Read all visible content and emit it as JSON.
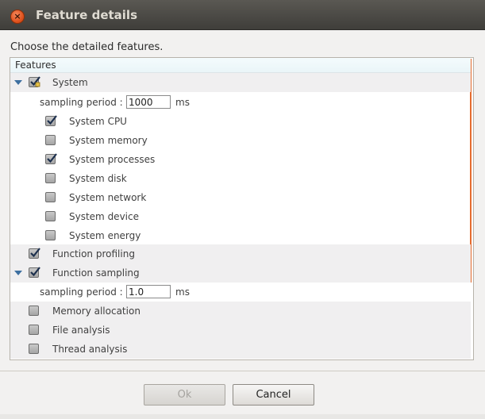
{
  "window": {
    "title": "Feature details"
  },
  "instruction": "Choose the detailed features.",
  "tree": {
    "column_header": "Features",
    "rows": [
      {
        "label": "System",
        "checked": true,
        "indeterminate": true
      },
      {
        "period_label": "sampling period :",
        "period_value": "1000",
        "unit": "ms"
      },
      {
        "label": "System CPU",
        "checked": true
      },
      {
        "label": "System memory",
        "checked": false
      },
      {
        "label": "System processes",
        "checked": true
      },
      {
        "label": "System disk",
        "checked": false
      },
      {
        "label": "System network",
        "checked": false
      },
      {
        "label": "System device",
        "checked": false
      },
      {
        "label": "System energy",
        "checked": false
      },
      {
        "label": "Function profiling",
        "checked": true
      },
      {
        "label": "Function sampling",
        "checked": true
      },
      {
        "period_label": "sampling period :",
        "period_value": "1.0",
        "unit": "ms"
      },
      {
        "label": "Memory allocation",
        "checked": false
      },
      {
        "label": "File analysis",
        "checked": false
      },
      {
        "label": "Thread analysis",
        "checked": false
      }
    ]
  },
  "buttons": {
    "ok": "Ok",
    "cancel": "Cancel"
  }
}
